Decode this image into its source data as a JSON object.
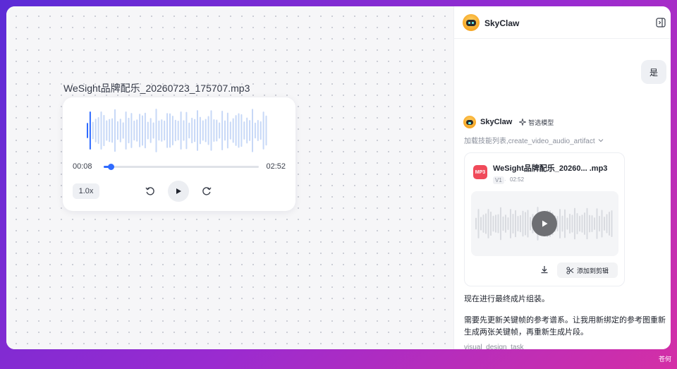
{
  "canvas": {
    "file_title": "WeSight品牌配乐_20260723_175707.mp3",
    "player": {
      "current_time": "00:08",
      "duration": "02:52",
      "progress": 0.047,
      "speed": "1.0x"
    }
  },
  "chat": {
    "header": {
      "name": "SkyClaw"
    },
    "user_message": "是",
    "bot": {
      "name": "SkyClaw",
      "model_label": "智选模型",
      "skill_line": "加载技能列表,create_video_audio_artifact"
    },
    "artifact": {
      "badge": "MP3",
      "title": "WeSight品牌配乐_20260...  .mp3",
      "version": "V1",
      "separator": "·",
      "duration": "02:52",
      "add_label": "添加到剪辑"
    },
    "message1": "现在进行最终成片组装。",
    "message2": "需要先更新关键帧的参考谱系。让我用新绑定的参考图重新生成两张关键帧，再重新生成片段。",
    "next_line": "visual_design_task"
  },
  "desktop": {
    "corner_text": "苍何"
  },
  "colors": {
    "accent": "#2f6bff",
    "badge": "#f04a5a"
  }
}
